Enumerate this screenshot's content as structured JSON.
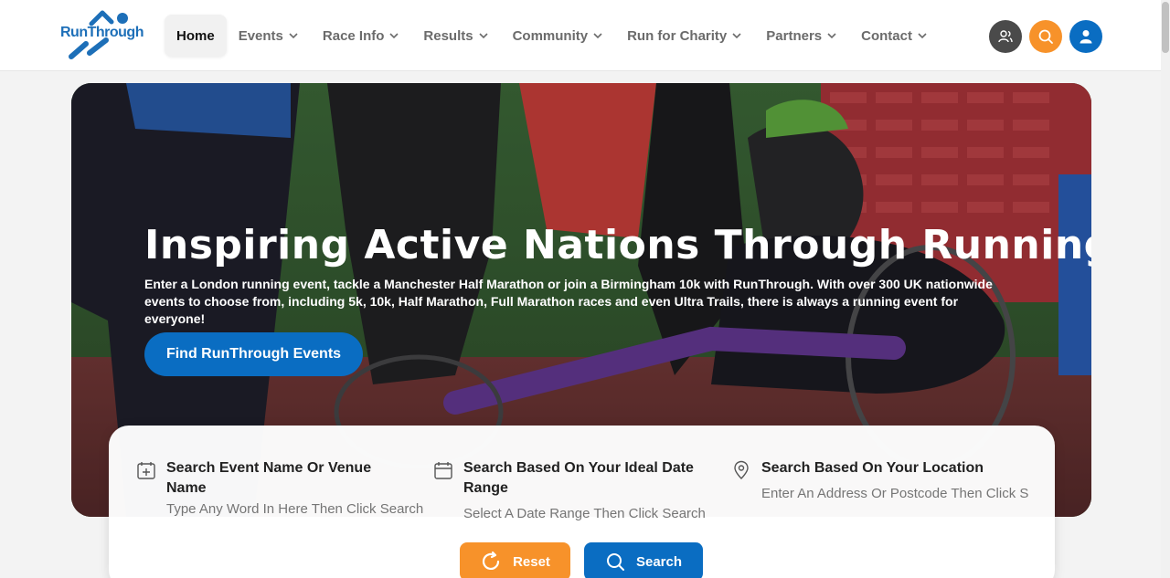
{
  "brand": {
    "logo_text": "RunThrough"
  },
  "nav": {
    "items": [
      {
        "label": "Home",
        "active": true
      },
      {
        "label": "Events"
      },
      {
        "label": "Race Info"
      },
      {
        "label": "Results"
      },
      {
        "label": "Community"
      },
      {
        "label": "Run for Charity"
      },
      {
        "label": "Partners"
      },
      {
        "label": "Contact"
      }
    ]
  },
  "header_buttons": [
    {
      "icon": "users-icon",
      "color": "#4a4a4a"
    },
    {
      "icon": "search-icon",
      "color": "#f7922a"
    },
    {
      "icon": "user-icon",
      "color": "#0a6dc2"
    }
  ],
  "hero": {
    "title": "Inspiring Active Nations Through Running",
    "description": "Enter a London running event, tackle a Manchester Half Marathon or join a Birmingham 10k with RunThrough. With over 300 UK nationwide events to choose from, including 5k, 10k, Half Marathon, Full Marathon races and even Ultra Trails, there is always a running event for everyone!",
    "cta_label": "Find RunThrough Events"
  },
  "search": {
    "name": {
      "title": "Search Event Name Or Venue Name",
      "placeholder": "Type Any Word In Here Then Click Search"
    },
    "date": {
      "title": "Search Based On Your Ideal Date Range",
      "placeholder": "Select A Date Range Then Click Search"
    },
    "location": {
      "title": "Search Based On Your Location",
      "placeholder": "Enter An Address Or Postcode Then Click S"
    },
    "reset_label": "Reset",
    "search_label": "Search"
  },
  "colors": {
    "primary": "#0a6dc2",
    "accent": "#f7922a",
    "dark": "#4a4a4a"
  }
}
